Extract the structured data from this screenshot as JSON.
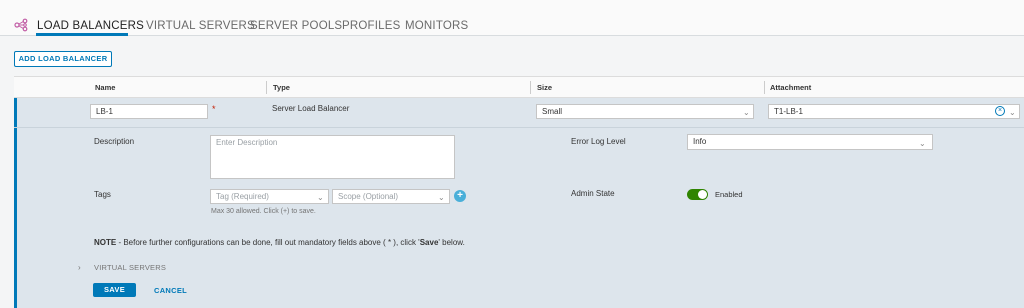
{
  "tabs": [
    {
      "label": "LOAD BALANCERS",
      "active": true
    },
    {
      "label": "VIRTUAL SERVERS",
      "active": false
    },
    {
      "label": "SERVER POOLS",
      "active": false
    },
    {
      "label": "PROFILES",
      "active": false
    },
    {
      "label": "MONITORS",
      "active": false
    }
  ],
  "toolbar": {
    "add_label": "ADD LOAD BALANCER"
  },
  "grid": {
    "headers": {
      "name": "Name",
      "type": "Type",
      "size": "Size",
      "attachment": "Attachment"
    }
  },
  "row": {
    "name_value": "LB-1",
    "type_value": "Server Load Balancer",
    "size_value": "Small",
    "attachment_value": "T1-LB-1",
    "description_label": "Description",
    "description_placeholder": "Enter Description",
    "error_log_label": "Error Log Level",
    "error_log_value": "Info",
    "tags_label": "Tags",
    "tag_placeholder": "Tag (Required)",
    "scope_placeholder": "Scope (Optional)",
    "tags_hint": "Max 30 allowed. Click (+) to save.",
    "admin_state_label": "Admin State",
    "admin_state_value": "Enabled",
    "note_prefix": "NOTE",
    "note_text": " - Before further configurations can be done, fill out mandatory fields above ( * ), click '",
    "note_save": "Save",
    "note_suffix": "' below.",
    "virtual_servers_label": "VIRTUAL SERVERS",
    "save_label": "SAVE",
    "cancel_label": "CANCEL"
  },
  "colors": {
    "accent": "#0079b8",
    "toggle_on": "#2f8400",
    "row_bg": "#dde5ec",
    "required": "#c21d00"
  }
}
